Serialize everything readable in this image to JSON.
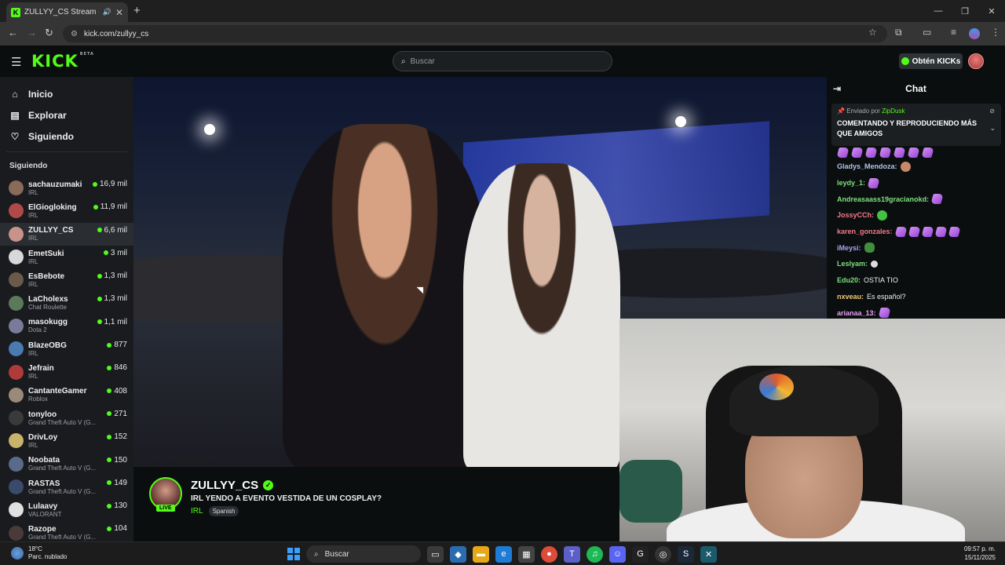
{
  "browser": {
    "tab_title": "ZULLYY_CS Stream - Watch",
    "tab_favicon": "K",
    "url": "kick.com/zullyy_cs",
    "window_controls": [
      "—",
      "❐",
      "✕"
    ]
  },
  "header": {
    "logo": "KICK",
    "logo_badge": "BETA",
    "search_placeholder": "Buscar",
    "get_kicks_label": "Obtén KICKs",
    "accent_color": "#53fc18"
  },
  "sidebar": {
    "nav": [
      {
        "label": "Inicio",
        "icon": "home-icon"
      },
      {
        "label": "Explorar",
        "icon": "compass-icon"
      },
      {
        "label": "Siguiendo",
        "icon": "heart-icon"
      }
    ],
    "following_heading": "Siguiendo",
    "channels": [
      {
        "name": "sachauzumaki",
        "category": "IRL",
        "viewers": "16,9 mil",
        "color": "#8a6a58"
      },
      {
        "name": "ElGiogloking",
        "category": "IRL",
        "viewers": "11,9 mil",
        "color": "#b04a4a"
      },
      {
        "name": "ZULLYY_CS",
        "category": "IRL",
        "viewers": "6,6 mil",
        "color": "#c9928a",
        "active": true
      },
      {
        "name": "EmetSuki",
        "category": "IRL",
        "viewers": "3 mil",
        "color": "#d8d8d8"
      },
      {
        "name": "EsBebote",
        "category": "IRL",
        "viewers": "1,3 mil",
        "color": "#6a5a4a"
      },
      {
        "name": "LaCholexs",
        "category": "Chat Roulette",
        "viewers": "1,3 mil",
        "color": "#5a7a5a"
      },
      {
        "name": "masokugg",
        "category": "Dota 2",
        "viewers": "1,1 mil",
        "color": "#7a7a9a"
      },
      {
        "name": "BlazeOBG",
        "category": "IRL",
        "viewers": "877",
        "color": "#4a7ab0"
      },
      {
        "name": "Jefrain",
        "category": "IRL",
        "viewers": "846",
        "color": "#b03a3a"
      },
      {
        "name": "CantanteGamer",
        "category": "Roblox",
        "viewers": "408",
        "color": "#9a8a7a"
      },
      {
        "name": "tonyloo",
        "category": "Grand Theft Auto V (G...",
        "viewers": "271",
        "color": "#3a3a3a"
      },
      {
        "name": "DrivLoy",
        "category": "IRL",
        "viewers": "152",
        "color": "#c8b46a"
      },
      {
        "name": "Noobata",
        "category": "Grand Theft Auto V (G...",
        "viewers": "150",
        "color": "#5a6a8a"
      },
      {
        "name": "RASTAS",
        "category": "Grand Theft Auto V (G...",
        "viewers": "149",
        "color": "#3a4a6a"
      },
      {
        "name": "Lulaavy",
        "category": "VALORANT",
        "viewers": "130",
        "color": "#e0e0e0"
      },
      {
        "name": "Razope",
        "category": "Grand Theft Auto V (G...",
        "viewers": "104",
        "color": "#4a3a3a"
      }
    ]
  },
  "stream": {
    "channel": "ZULLYY_CS",
    "live_badge": "LIVE",
    "title": "IRL YENDO A EVENTO VESTIDA DE UN COSPLAY?",
    "category": "IRL",
    "language_tag": "Spanish"
  },
  "chat": {
    "heading": "Chat",
    "pinned": {
      "sent_by_prefix": "Enviado por",
      "sent_by_user": "ZipDusk",
      "message": "COMENTANDO Y REPRODUCIENDO MÁS QUE AMIGOS"
    },
    "messages": [
      {
        "user": "Gladys_Mendoza:",
        "color": "#b0c4e8",
        "text": "",
        "emotes": [
          "f"
        ]
      },
      {
        "user": "leydy_1:",
        "color": "#7ee07e",
        "text": "",
        "emotes": [
          "p"
        ]
      },
      {
        "user": "Andreasaass19gracianokd:",
        "color": "#7ee07e",
        "text": "",
        "emotes": [
          "p"
        ]
      },
      {
        "user": "JossyCCh:",
        "color": "#f07a8a",
        "text": "",
        "emotes": [
          "g"
        ]
      },
      {
        "user": "karen_gonzales:",
        "color": "#f07a8a",
        "text": "",
        "emotes": [
          "p",
          "p",
          "p",
          "p",
          "p"
        ]
      },
      {
        "user": "iMeysi:",
        "color": "#b0a0f0",
        "text": "",
        "emotes": [
          "fr"
        ]
      },
      {
        "user": "Leslyam:",
        "color": "#7ee07e",
        "text": "",
        "emotes": [
          "w"
        ]
      },
      {
        "user": "Edu20:",
        "color": "#7ee07e",
        "text": "OSTIA TIO",
        "emotes": []
      },
      {
        "user": "nxveau:",
        "color": "#f0c87a",
        "text": "Es español?",
        "emotes": []
      },
      {
        "user": "arianaa_13:",
        "color": "#e0a0f0",
        "text": "",
        "emotes": [
          "p"
        ]
      }
    ]
  },
  "taskbar": {
    "temperature": "18°C",
    "weather": "Parc. nublado",
    "search_label": "Buscar",
    "time": "09:57 p. m.",
    "date": "15/11/2025"
  }
}
